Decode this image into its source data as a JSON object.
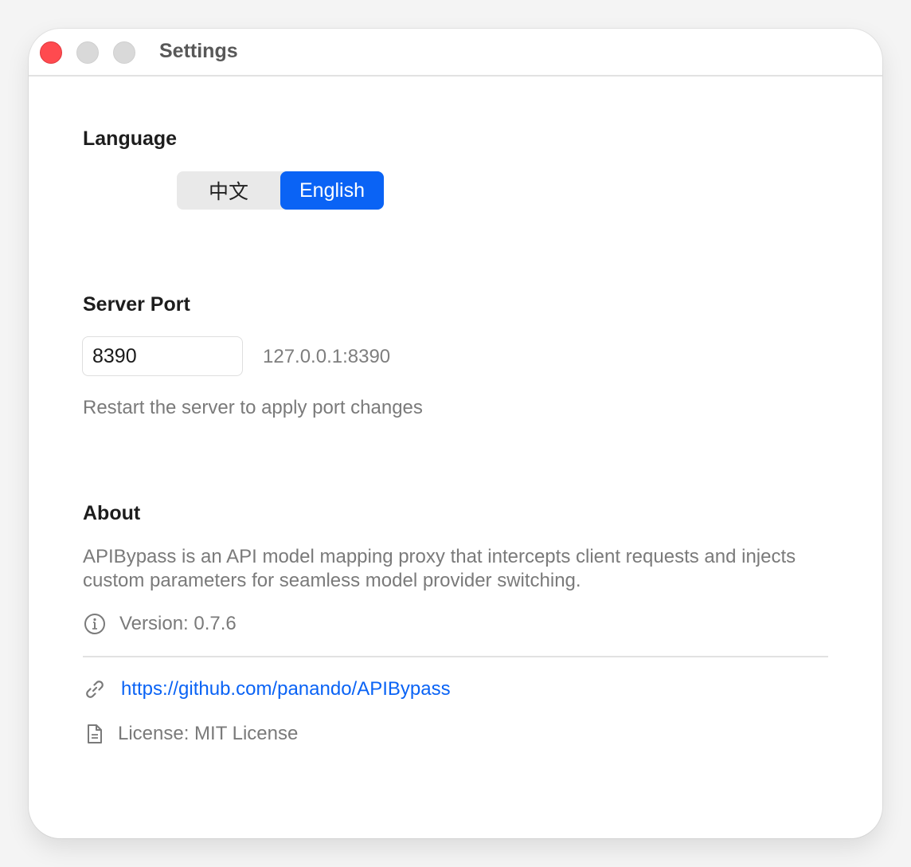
{
  "window": {
    "title": "Settings"
  },
  "language": {
    "heading": "Language",
    "options": [
      "中文",
      "English"
    ],
    "selected": "English"
  },
  "server_port": {
    "heading": "Server Port",
    "port_value": "8390",
    "address": "127.0.0.1:8390",
    "hint": "Restart the server to apply port changes"
  },
  "about": {
    "heading": "About",
    "description": "APIBypass is an API model mapping proxy that intercepts client requests and injects custom parameters for seamless model provider switching.",
    "version": "Version: 0.7.6",
    "link": "https://github.com/panando/APIBypass",
    "license": "License: MIT License"
  },
  "icons": {
    "version": "info-circle-icon",
    "link": "link-icon",
    "license": "document-icon"
  },
  "colors": {
    "accent": "#0a63f5",
    "close": "#ff4a4f"
  }
}
